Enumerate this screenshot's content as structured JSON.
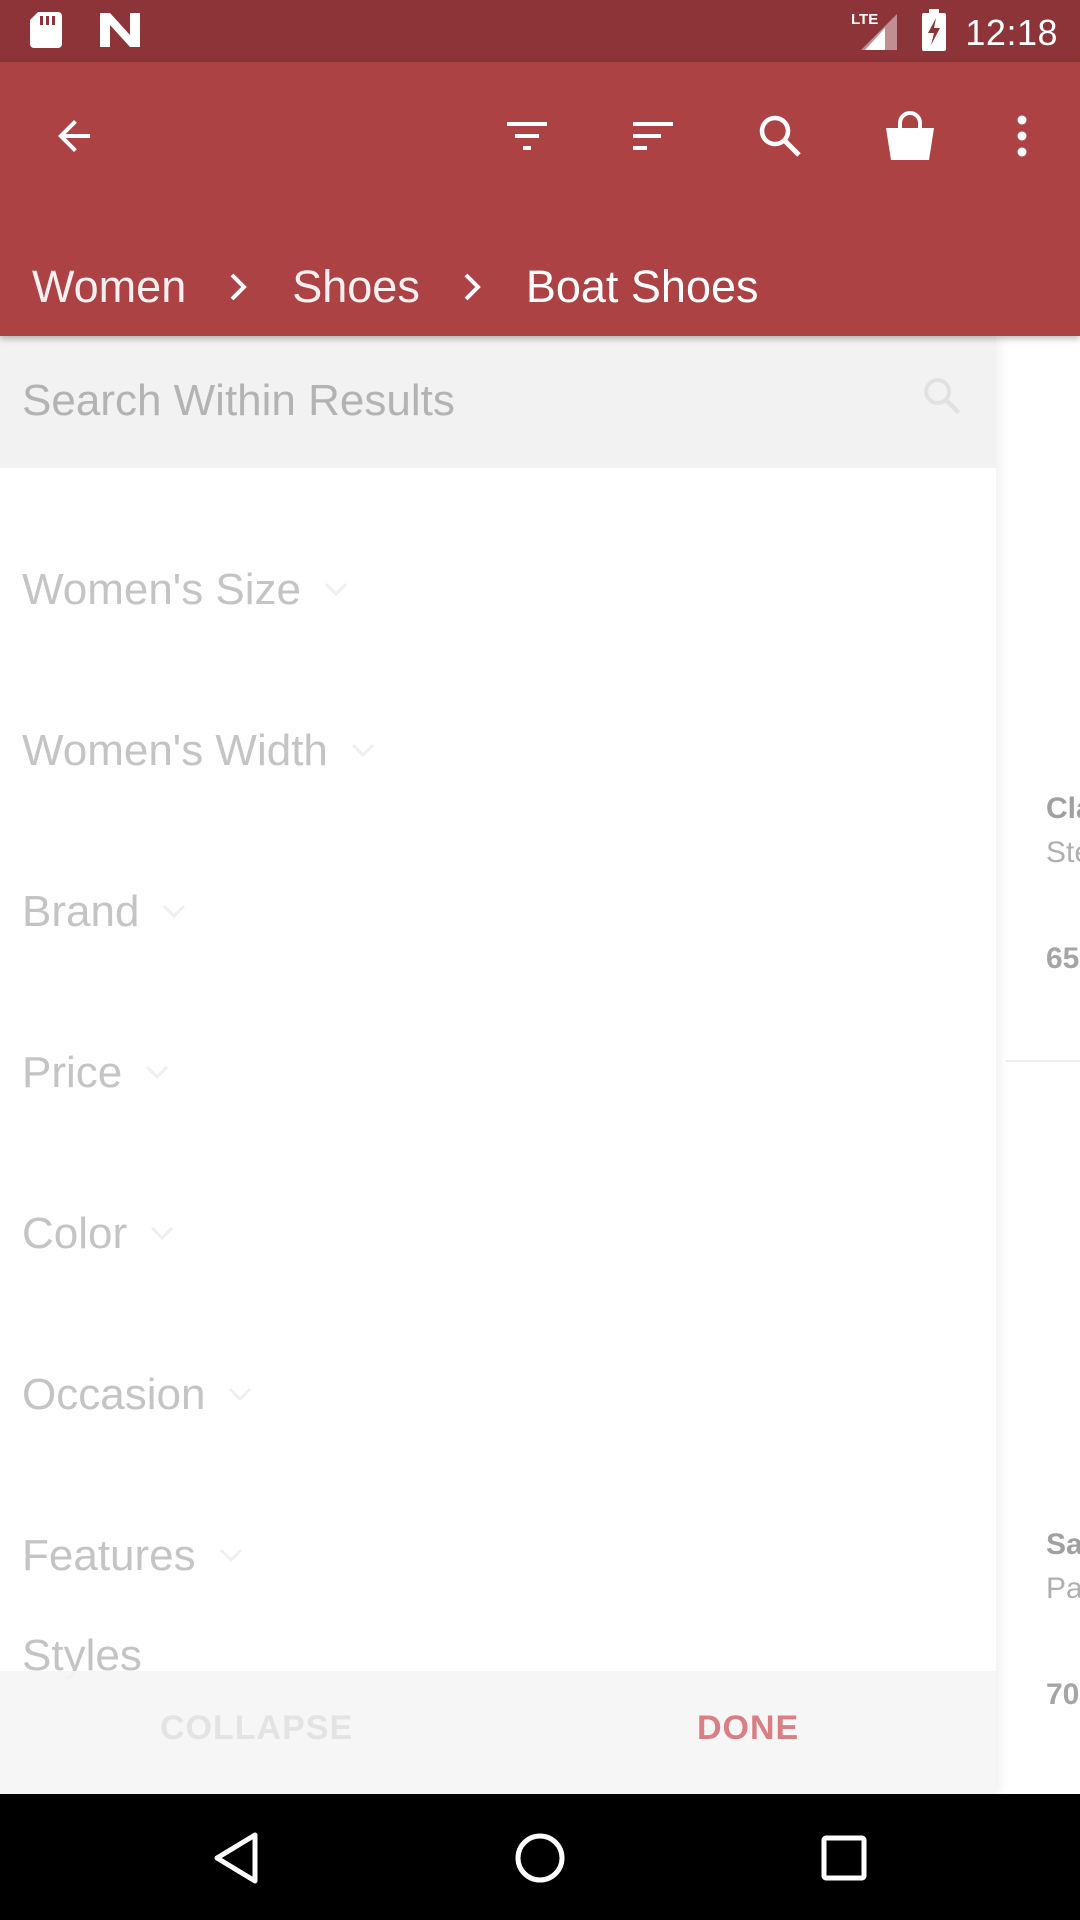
{
  "status_bar": {
    "time": "12:18",
    "network": "LTE",
    "left_icons": [
      "sd-card-icon",
      "n-logo-icon"
    ]
  },
  "app_bar": {
    "icons": [
      "back-arrow-icon",
      "filter-icon",
      "sort-icon",
      "search-icon",
      "shopping-bag-icon",
      "more-vert-icon"
    ],
    "breadcrumb": [
      {
        "label": "Women"
      },
      {
        "label": "Shoes"
      },
      {
        "label": "Boat Shoes"
      }
    ]
  },
  "drawer": {
    "search": {
      "placeholder": "Search Within Results",
      "value": ""
    },
    "filters": [
      {
        "label": "Women's Size"
      },
      {
        "label": "Women's Width"
      },
      {
        "label": "Brand"
      },
      {
        "label": "Price"
      },
      {
        "label": "Color"
      },
      {
        "label": "Occasion"
      },
      {
        "label": "Features"
      },
      {
        "label": "Styles"
      }
    ],
    "collapse_label": "COLLAPSE",
    "done_label": "DONE"
  },
  "products": [
    {
      "title": "Cla",
      "subtitle": "Ste",
      "price": "65"
    },
    {
      "title": "Sa",
      "subtitle": "Pa",
      "price": "70"
    }
  ],
  "colors": {
    "status_bar": "#8c3437",
    "app_bar": "#ad4245",
    "accent_done": "#d97f84"
  }
}
